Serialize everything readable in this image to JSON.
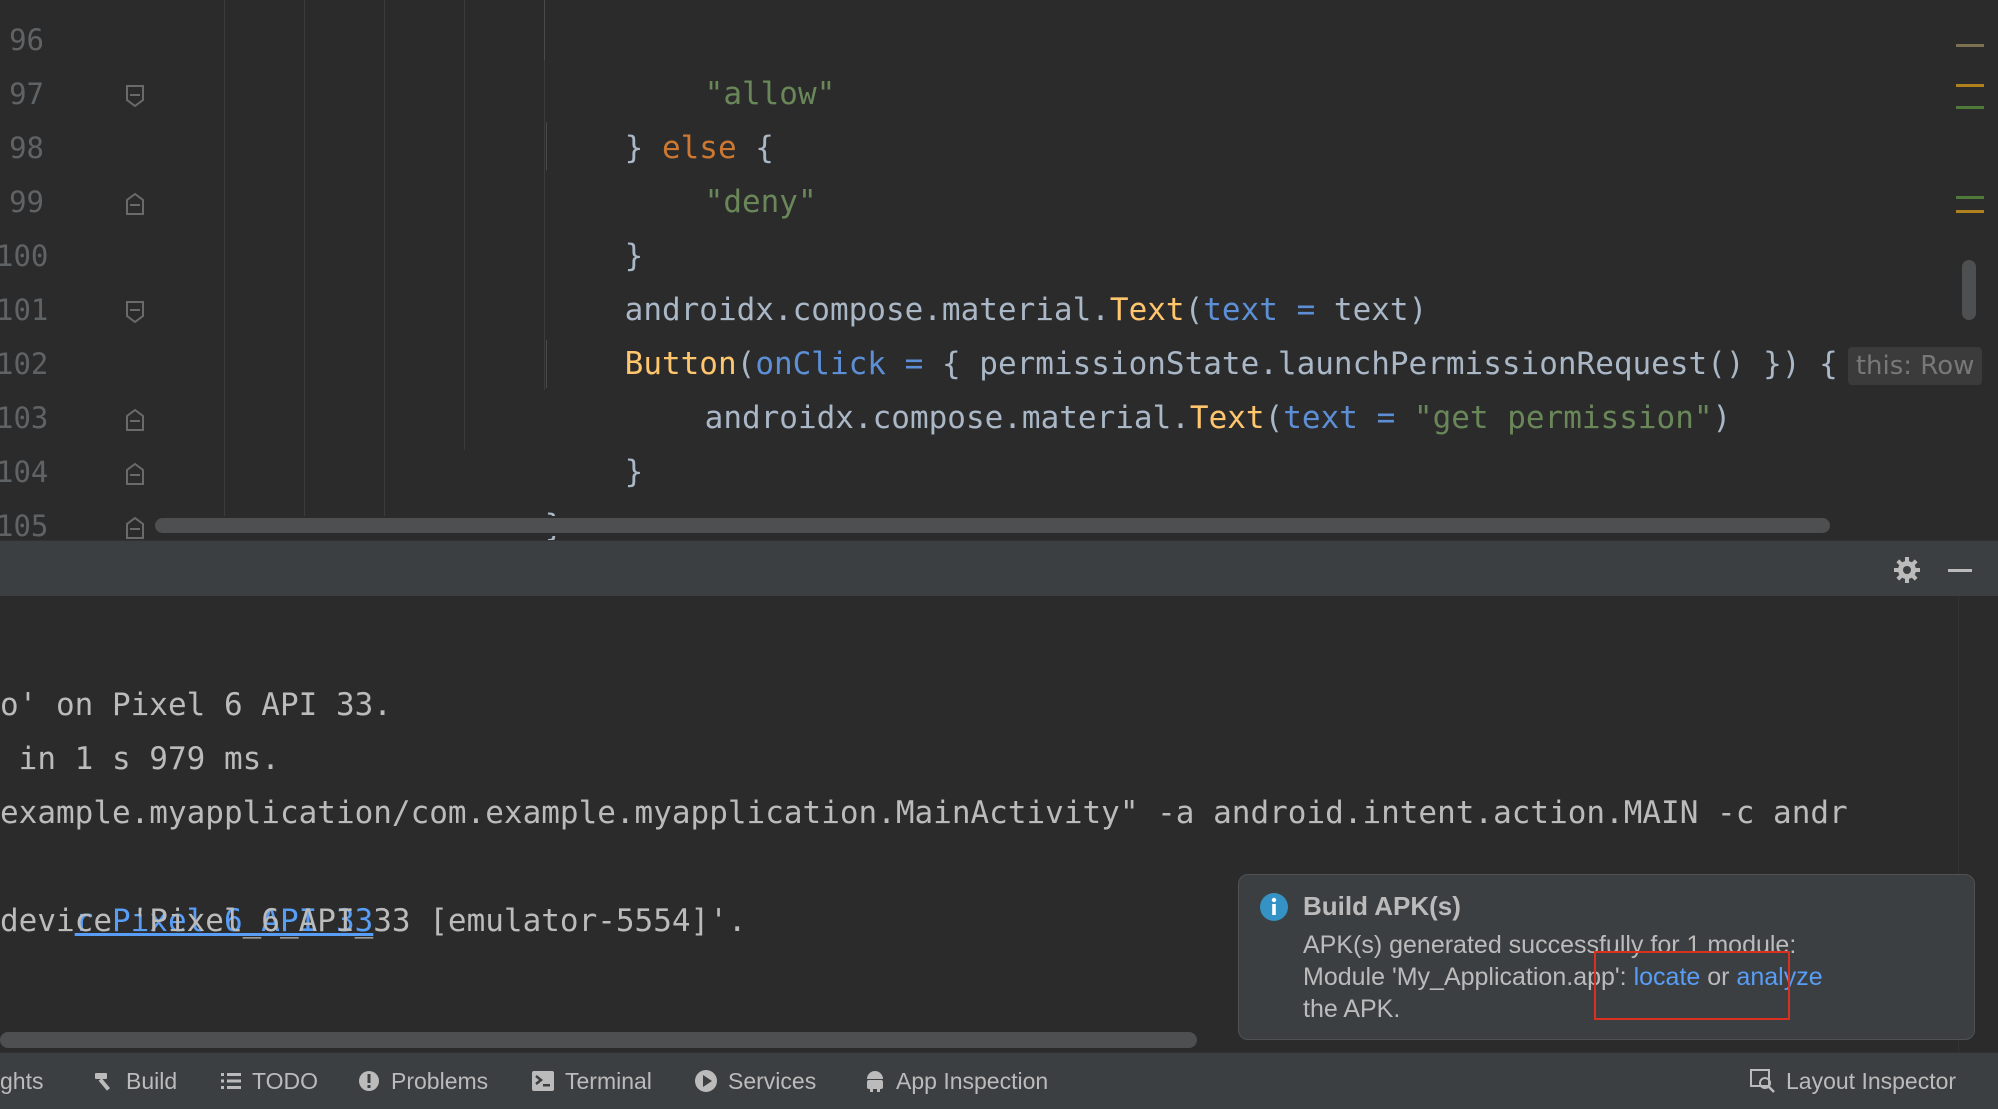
{
  "editor": {
    "line_numbers": [
      "96",
      "97",
      "98",
      "99",
      "100",
      "101",
      "102",
      "103",
      "104",
      "105"
    ],
    "lines": [
      {
        "string": "\"allow\""
      },
      {
        "open": "} ",
        "keyword": "else",
        "close": " {"
      },
      {
        "string": "\"deny\""
      },
      {
        "brace": "}"
      },
      {
        "prefix": "androidx.compose.material.",
        "fn": "Text",
        "open": "(",
        "param": "text",
        "eq": " = ",
        "value": "text",
        "close": ")"
      },
      {
        "fn": "Button",
        "open": "(",
        "param": "onClick",
        "eq": " = ",
        "rest": "{ permissionState.launchPermissionRequest() }) {",
        "hint": "this: Row"
      },
      {
        "prefix": "androidx.compose.material.",
        "fn": "Text",
        "open": "(",
        "param": "text",
        "eq": " = ",
        "string": "\"get permission\"",
        "close": ")"
      },
      {
        "brace": "}"
      },
      {
        "brace": "}"
      },
      {
        "brace": ""
      }
    ]
  },
  "console": {
    "lines": [
      "o' on Pixel 6 API 33.",
      " in 1 s 979 ms.",
      "example.myapplication/com.example.myapplication.MainActivity\" -a android.intent.action.MAIN -c andr",
      "r Pixel 6 API 33",
      "device 'Pixel_6_API_33 [emulator-5554]'."
    ]
  },
  "notification": {
    "title": "Build APK(s)",
    "line1": "APK(s) generated successfully for 1 module:",
    "line2_prefix": "Module 'My_Application.app': ",
    "locate": "locate",
    "or": " or ",
    "analyze": "analyze",
    "line3": "the APK."
  },
  "bottom_bar": {
    "insights": "ghts",
    "build": "Build",
    "todo": "TODO",
    "problems": "Problems",
    "terminal": "Terminal",
    "services": "Services",
    "app_inspection": "App Inspection",
    "layout_inspector": "Layout Inspector"
  },
  "colors": {
    "keyword": "#cc7832",
    "string": "#6a8759",
    "function": "#ffc66d",
    "parameter": "#5c8fd6",
    "link": "#589df6",
    "highlight_box": "#d9301f"
  }
}
